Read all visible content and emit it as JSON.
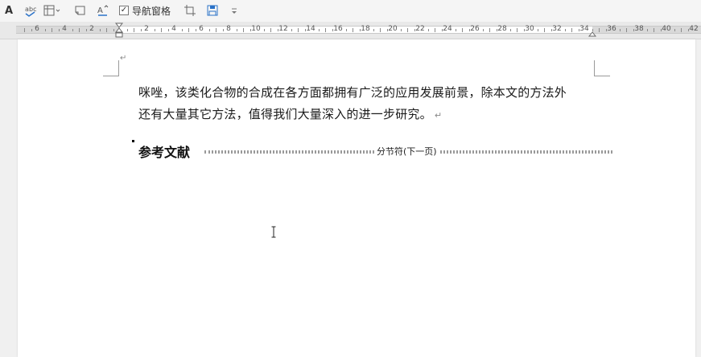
{
  "toolbar": {
    "nav_pane_label": "导航窗格",
    "nav_pane_checked": "✓"
  },
  "ruler": {
    "left_labels": [
      "6",
      "4",
      "2"
    ],
    "right_labels": [
      "2",
      "4",
      "6",
      "8",
      "10",
      "12",
      "14",
      "16",
      "18",
      "20",
      "22",
      "24",
      "26",
      "28",
      "30",
      "32",
      "34",
      "36",
      "38",
      "40",
      "42"
    ]
  },
  "document": {
    "paragraph_line1": "咪唑，该类化合物的合成在各方面都拥有广泛的应用发展前景，除本文的方法外",
    "paragraph_line2": "还有大量其它方法，值得我们大量深入的进一步研究。",
    "heading": "参考文献",
    "section_break_label": "分节符(下一页)",
    "paragraph_mark": "↵"
  }
}
